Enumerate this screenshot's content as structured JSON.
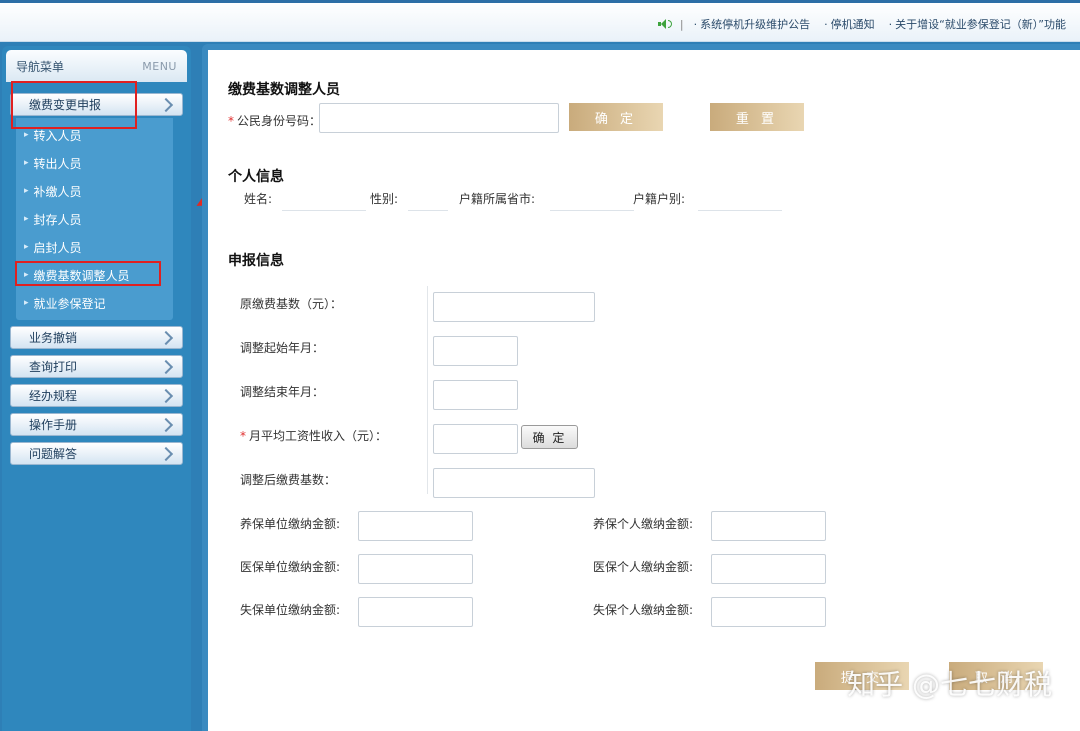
{
  "top_notice": {
    "items": [
      "系统停机升级维护公告",
      "停机通知",
      "关于增设“就业参保登记（新）”功能"
    ]
  },
  "sidebar": {
    "title": "导航菜单",
    "menu_label": "MENU",
    "active_group": "缴费变更申报",
    "sub_items": [
      "转入人员",
      "转出人员",
      "补缴人员",
      "封存人员",
      "启封人员",
      "缴费基数调整人员",
      "就业参保登记"
    ],
    "groups": [
      "业务撤销",
      "查询打印",
      "经办规程",
      "操作手册",
      "问题解答"
    ]
  },
  "main": {
    "page_title": "缴费基数调整人员",
    "required_mark": "*",
    "id_label": "公民身份号码：",
    "id_value": "",
    "confirm_label": "确 定",
    "reset_label": "重 置",
    "personal": {
      "title": "个人信息",
      "name_label": "姓名:",
      "gender_label": "性别:",
      "province_label": "户籍所属省市:",
      "hukou_label": "户籍户别:"
    },
    "report": {
      "title": "申报信息",
      "orig_base_label": "原缴费基数（元）：",
      "adj_start_label": "调整起始年月：",
      "adj_end_label": "调整结束年月：",
      "monthly_wage_label": "月平均工资性收入（元）：",
      "wage_confirm_label": "确 定",
      "adj_base_label": "调整后缴费基数：",
      "pension_unit_label": "养保单位缴纳金额:",
      "pension_person_label": "养保个人缴纳金额:",
      "medical_unit_label": "医保单位缴纳金额:",
      "medical_person_label": "医保个人缴纳金额:",
      "unemp_unit_label": "失保单位缴纳金额:",
      "unemp_person_label": "失保个人缴纳金额:"
    },
    "submit_label": "提 交",
    "cancel_label": "取 消",
    "watermark": "知乎 @七七财税"
  }
}
